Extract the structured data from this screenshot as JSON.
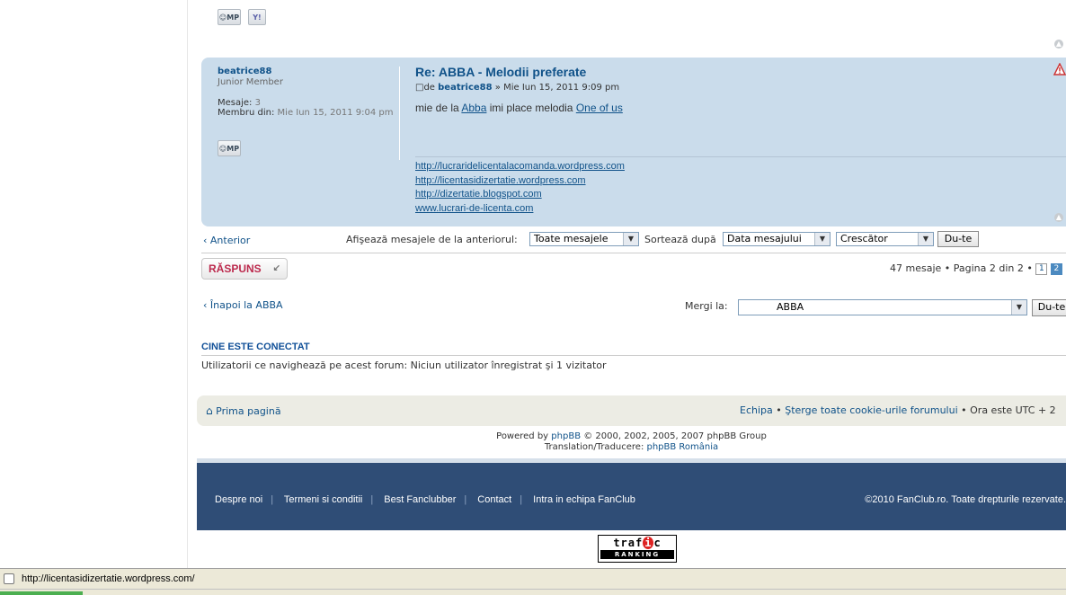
{
  "post": {
    "username": "beatrice88",
    "rank": "Junior Member",
    "posts_label": "Mesaje:",
    "posts_value": "3",
    "joined_label": "Membru din:",
    "joined_value": "Mie Iun 15, 2011 9:04 pm",
    "title": "Re: ABBA - Melodii preferate",
    "by_prefix": "de",
    "author": "beatrice88",
    "date": "» Mie Iun 15, 2011 9:09 pm",
    "content_prefix": "mie de la",
    "content_link1": "Abba",
    "content_mid": "imi place melodia",
    "content_link2": "One of us",
    "signature_links": [
      "http://lucraridelicentalacomanda.wordpress.com",
      "http://licentasidizertatie.wordpress.com",
      "http://dizertatie.blogspot.com",
      "www.lucrari-de-licenta.com"
    ],
    "pm_label": "MP",
    "yim_label": "Y!"
  },
  "nav": {
    "previous": "Anterior",
    "display_label": "Afişează mesajele de la anteriorul:",
    "display_value": "Toate mesajele",
    "sort_label": "Sortează după",
    "sort_value": "Data mesajului",
    "order_value": "Crescător",
    "go_label": "Du-te"
  },
  "pagination": {
    "reply_label": "RĂSPUNS",
    "summary": "47 mesaje • Pagina 2 din 2 •",
    "pages": [
      "1",
      "2"
    ]
  },
  "jump": {
    "back_label": "Înapoi la ABBA",
    "jump_label": "Mergi la:",
    "jump_value": "ABBA",
    "go_label": "Du-te"
  },
  "online": {
    "title": "CINE ESTE CONECTAT",
    "text": "Utilizatorii ce navighează pe acest forum: Niciun utilizator înregistrat şi 1 vizitator"
  },
  "footer": {
    "home_label": "Prima pagină",
    "team_label": "Echipa",
    "cookies_label": "Şterge toate cookie-urile forumului",
    "timezone": "Ora este UTC + 2",
    "powered_prefix": "Powered by",
    "powered_link": "phpBB",
    "powered_suffix": "© 2000, 2002, 2005, 2007 phpBB Group",
    "translation_prefix": "Translation/Traducere:",
    "translation_link": "phpBB România"
  },
  "site_footer": {
    "links": [
      "Despre noi",
      "Termeni si conditii",
      "Best Fanclubber",
      "Contact",
      "Intra in echipa FanClub"
    ],
    "copyright": "©2010 FanClub.ro. Toate drepturile rezervate."
  },
  "badge": {
    "line1_a": "traf",
    "line1_b": "i",
    "line1_c": "c",
    "line2": "RANKING"
  },
  "statusbar": {
    "url": "http://licentasidizertatie.wordpress.com/"
  },
  "colors": {
    "post_bg": "#cadceb",
    "link": "#105289",
    "reply_text": "#bc2a4d",
    "footer_dark": "#2f4d76"
  }
}
